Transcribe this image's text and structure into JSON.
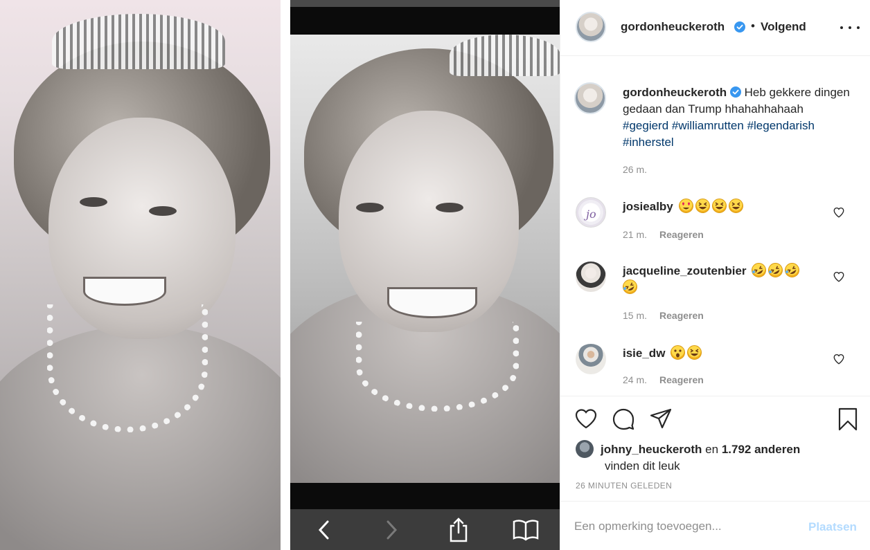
{
  "post": {
    "author": "gordonheuckeroth",
    "follow_dot": "•",
    "follow_label": "Volgend",
    "caption_user": "gordonheuckeroth",
    "caption_text": "Heb gekkere dingen gedaan dan Trump hhahahhahaah",
    "caption_tags": [
      "#gegierd",
      "#williamrutten",
      "#legendarish",
      "#inherstel"
    ],
    "caption_time": "26 m.",
    "verified_color": "#3897f0"
  },
  "comments": [
    {
      "user": "josiealby",
      "emojis": [
        "heart-eyes",
        "grin-squint",
        "grin-squint",
        "grin-squint"
      ],
      "time": "21 m.",
      "reply": "Reageren"
    },
    {
      "user": "jacqueline_zoutenbier",
      "emojis": [
        "rofl",
        "rofl",
        "rofl",
        "rofl"
      ],
      "time": "15 m.",
      "reply": "Reageren"
    },
    {
      "user": "isie_dw",
      "emojis": [
        "astonished",
        "grin-squint"
      ],
      "time": "24 m.",
      "reply": "Reageren"
    }
  ],
  "likes": {
    "first_user": "johny_heuckeroth",
    "connector": "en",
    "others": "1.792 anderen",
    "suffix": "vinden dit leuk"
  },
  "timestamp": "26 MINUTEN GELEDEN",
  "add_comment": {
    "placeholder": "Een opmerking toevoegen...",
    "submit_label": "Plaatsen"
  }
}
